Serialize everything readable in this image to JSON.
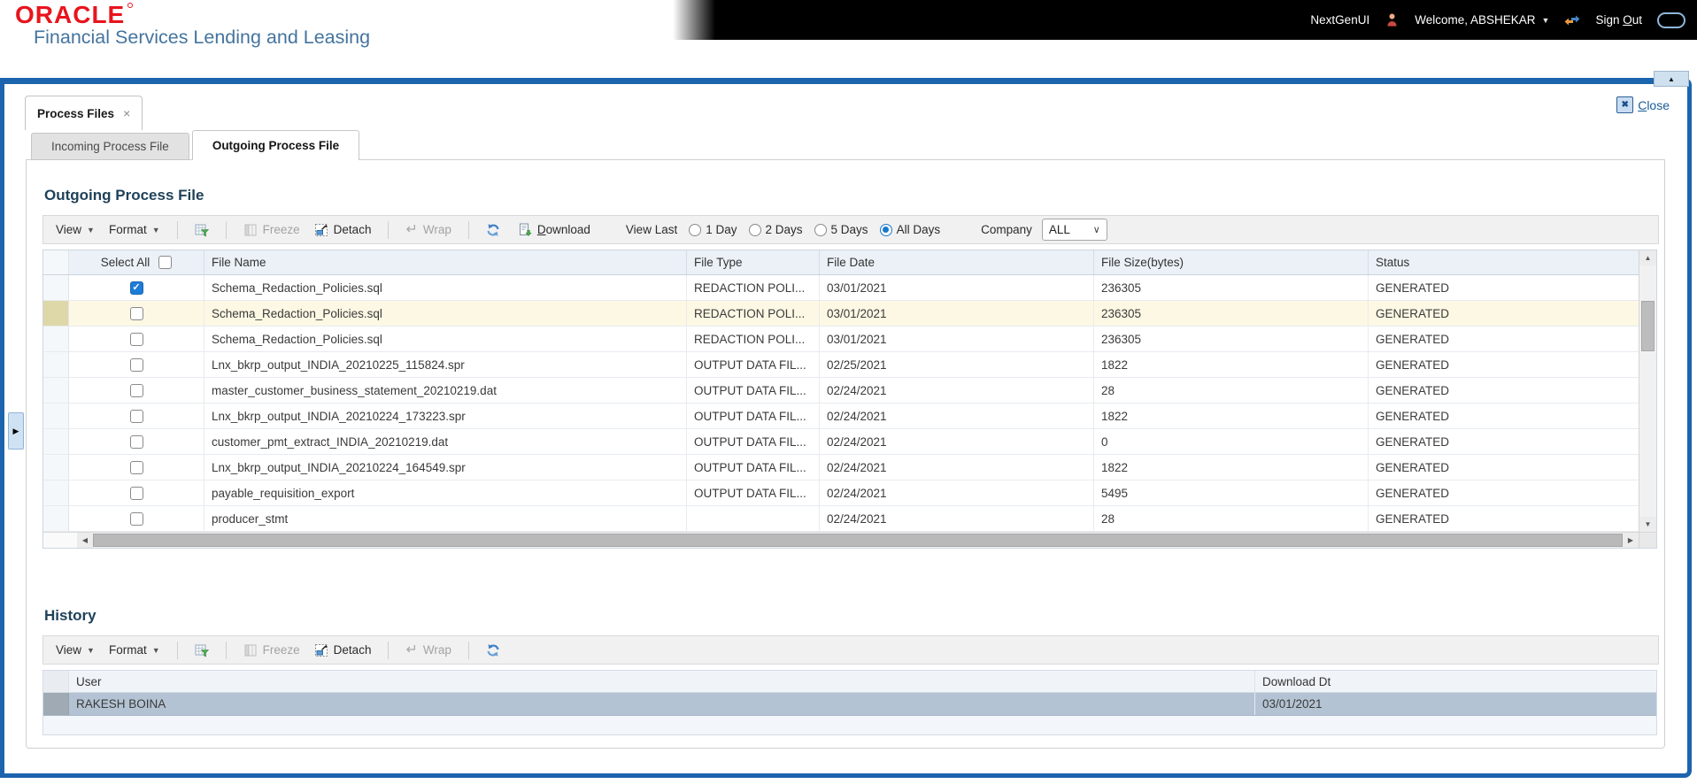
{
  "header": {
    "brand": "ORACLE",
    "brand_tagline": "Financial Services Lending and Leasing",
    "nav_link": "NextGenUI",
    "welcome": "Welcome, ABSHEKAR",
    "sign_out": "Sign Out"
  },
  "window": {
    "tab_title": "Process Files",
    "close_label": "Close"
  },
  "tabs": [
    {
      "label": "Incoming Process File"
    },
    {
      "label": "Outgoing Process File"
    }
  ],
  "toolbar_labels": {
    "view": "View",
    "format": "Format",
    "freeze": "Freeze",
    "detach": "Detach",
    "wrap": "Wrap",
    "download": "Download"
  },
  "outgoing": {
    "title": "Outgoing Process File",
    "view_last": {
      "label": "View Last",
      "options": [
        {
          "label": "1 Day",
          "selected": false
        },
        {
          "label": "2 Days",
          "selected": false
        },
        {
          "label": "5 Days",
          "selected": false
        },
        {
          "label": "All Days",
          "selected": true
        }
      ]
    },
    "company": {
      "label": "Company",
      "value": "ALL"
    },
    "table": {
      "select_all_label": "Select All",
      "columns": [
        "File Name",
        "File Type",
        "File Date",
        "File Size(bytes)",
        "Status"
      ],
      "rows": [
        {
          "checked": true,
          "highlight": false,
          "file_name": "Schema_Redaction_Policies.sql",
          "file_type": "REDACTION POLI...",
          "file_date": "03/01/2021",
          "file_size": "236305",
          "status": "GENERATED"
        },
        {
          "checked": false,
          "highlight": true,
          "file_name": "Schema_Redaction_Policies.sql",
          "file_type": "REDACTION POLI...",
          "file_date": "03/01/2021",
          "file_size": "236305",
          "status": "GENERATED"
        },
        {
          "checked": false,
          "highlight": false,
          "file_name": "Schema_Redaction_Policies.sql",
          "file_type": "REDACTION POLI...",
          "file_date": "03/01/2021",
          "file_size": "236305",
          "status": "GENERATED"
        },
        {
          "checked": false,
          "highlight": false,
          "file_name": "Lnx_bkrp_output_INDIA_20210225_115824.spr",
          "file_type": "OUTPUT DATA FIL...",
          "file_date": "02/25/2021",
          "file_size": "1822",
          "status": "GENERATED"
        },
        {
          "checked": false,
          "highlight": false,
          "file_name": "master_customer_business_statement_20210219.dat",
          "file_type": "OUTPUT DATA FIL...",
          "file_date": "02/24/2021",
          "file_size": "28",
          "status": "GENERATED"
        },
        {
          "checked": false,
          "highlight": false,
          "file_name": "Lnx_bkrp_output_INDIA_20210224_173223.spr",
          "file_type": "OUTPUT DATA FIL...",
          "file_date": "02/24/2021",
          "file_size": "1822",
          "status": "GENERATED"
        },
        {
          "checked": false,
          "highlight": false,
          "file_name": "customer_pmt_extract_INDIA_20210219.dat",
          "file_type": "OUTPUT DATA FIL...",
          "file_date": "02/24/2021",
          "file_size": "0",
          "status": "GENERATED"
        },
        {
          "checked": false,
          "highlight": false,
          "file_name": "Lnx_bkrp_output_INDIA_20210224_164549.spr",
          "file_type": "OUTPUT DATA FIL...",
          "file_date": "02/24/2021",
          "file_size": "1822",
          "status": "GENERATED"
        },
        {
          "checked": false,
          "highlight": false,
          "file_name": "payable_requisition_export",
          "file_type": "OUTPUT DATA FIL...",
          "file_date": "02/24/2021",
          "file_size": "5495",
          "status": "GENERATED"
        },
        {
          "checked": false,
          "highlight": false,
          "file_name": "producer_stmt",
          "file_type": "",
          "file_date": "02/24/2021",
          "file_size": "28",
          "status": "GENERATED"
        }
      ]
    }
  },
  "history": {
    "title": "History",
    "columns": [
      "User",
      "Download Dt"
    ],
    "rows": [
      {
        "user": "RAKESH BOINA",
        "download_dt": "03/01/2021"
      }
    ]
  },
  "colors": {
    "brand_red": "#e8141d",
    "brand_blue": "#44749e",
    "frame_blue": "#1c64ae",
    "heading_navy": "#1f4259",
    "radio_blue": "#1979ca",
    "checkbox_blue": "#1e7cd7",
    "highlight_row_bg": "#fdf8e4",
    "history_selected_row_bg": "#b3c3d3"
  }
}
